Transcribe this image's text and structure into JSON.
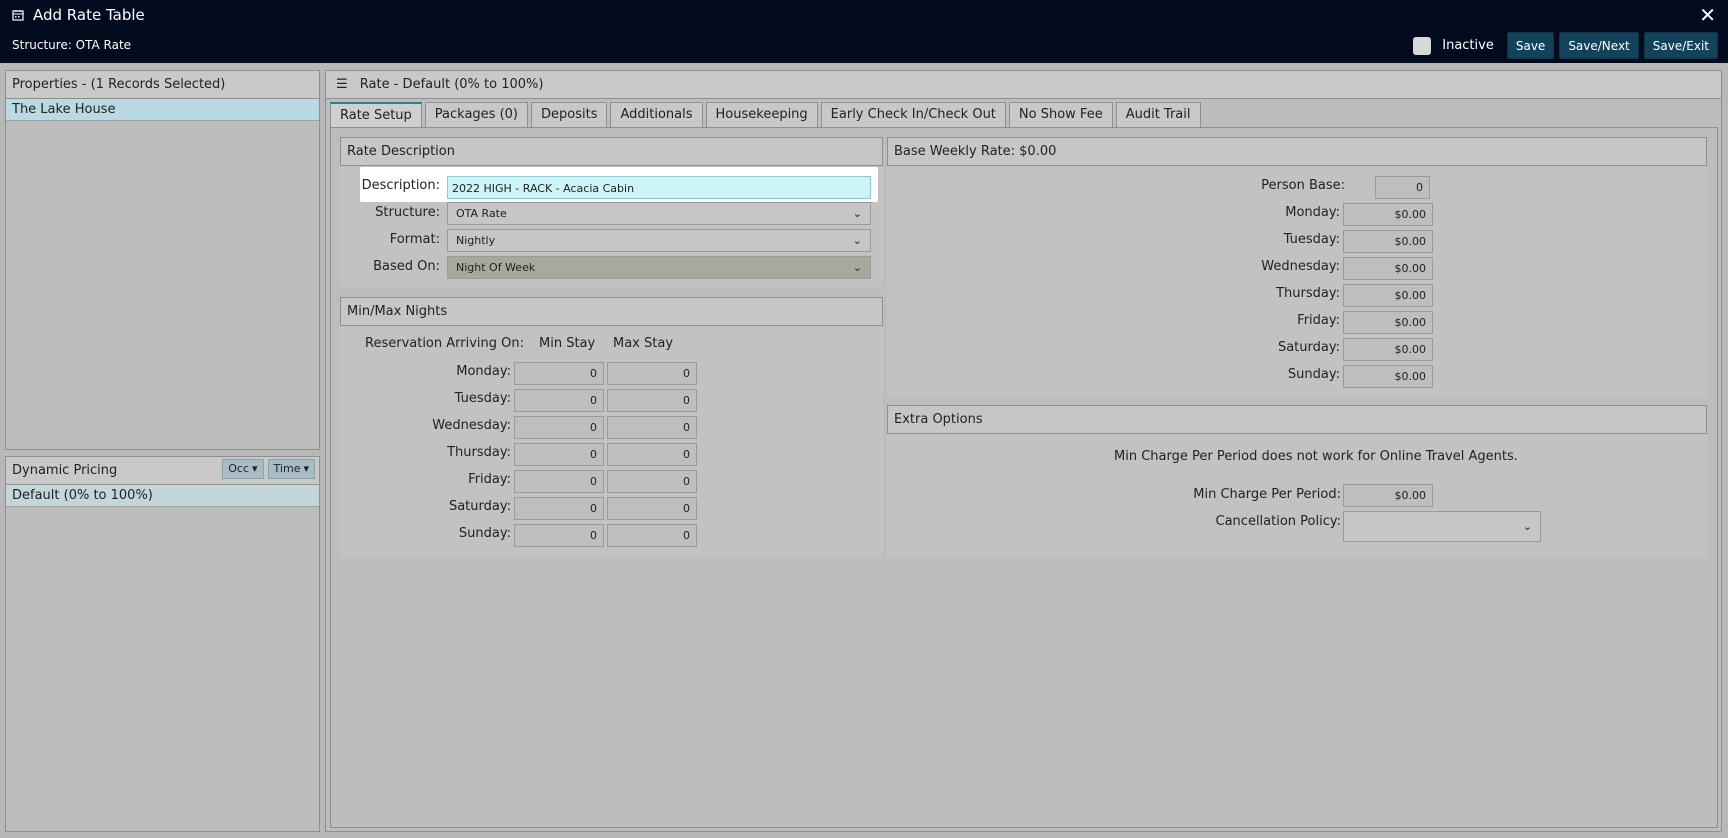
{
  "window": {
    "title": "Add Rate Table",
    "subtitle": "Structure: OTA Rate"
  },
  "toolbar": {
    "inactive_label": "Inactive",
    "save": "Save",
    "save_next": "Save/Next",
    "save_exit": "Save/Exit"
  },
  "properties": {
    "header": "Properties - (1 Records Selected)",
    "selected": "The Lake House"
  },
  "dynamic_pricing": {
    "header": "Dynamic Pricing",
    "occ_label": "Occ",
    "time_label": "Time",
    "selected": "Default (0% to 100%)"
  },
  "main": {
    "header": "Rate - Default (0% to 100%)"
  },
  "tabs": [
    "Rate Setup",
    "Packages (0)",
    "Deposits",
    "Additionals",
    "Housekeeping",
    "Early Check In/Check Out",
    "No Show Fee",
    "Audit Trail"
  ],
  "rate_description": {
    "header": "Rate Description",
    "description_label": "Description:",
    "description_value": "2022 HIGH - RACK - Acacia Cabin",
    "structure_label": "Structure:",
    "structure_value": "OTA Rate",
    "format_label": "Format:",
    "format_value": "Nightly",
    "based_on_label": "Based On:",
    "based_on_value": "Night Of Week"
  },
  "minmax": {
    "header": "Min/Max Nights",
    "arriving_label": "Reservation Arriving On:",
    "min_label": "Min Stay",
    "max_label": "Max Stay",
    "rows": [
      {
        "day": "Monday:",
        "min": "0",
        "max": "0"
      },
      {
        "day": "Tuesday:",
        "min": "0",
        "max": "0"
      },
      {
        "day": "Wednesday:",
        "min": "0",
        "max": "0"
      },
      {
        "day": "Thursday:",
        "min": "0",
        "max": "0"
      },
      {
        "day": "Friday:",
        "min": "0",
        "max": "0"
      },
      {
        "day": "Saturday:",
        "min": "0",
        "max": "0"
      },
      {
        "day": "Sunday:",
        "min": "0",
        "max": "0"
      }
    ]
  },
  "base_weekly": {
    "header": "Base Weekly Rate: $0.00",
    "person_base_label": "Person Base:",
    "person_base_value": "0",
    "rows": [
      {
        "day": "Monday:",
        "value": "$0.00"
      },
      {
        "day": "Tuesday:",
        "value": "$0.00"
      },
      {
        "day": "Wednesday:",
        "value": "$0.00"
      },
      {
        "day": "Thursday:",
        "value": "$0.00"
      },
      {
        "day": "Friday:",
        "value": "$0.00"
      },
      {
        "day": "Saturday:",
        "value": "$0.00"
      },
      {
        "day": "Sunday:",
        "value": "$0.00"
      }
    ]
  },
  "extra_options": {
    "header": "Extra Options",
    "note": "Min Charge Per Period does not work for Online Travel Agents.",
    "min_charge_label": "Min Charge Per Period:",
    "min_charge_value": "$0.00",
    "cancellation_label": "Cancellation Policy:",
    "cancellation_value": ""
  },
  "colors": {
    "topbar": "#020b1d",
    "button": "#13435a",
    "selected_row": "#b9dae2",
    "highlight_input": "#cdf5f8"
  }
}
